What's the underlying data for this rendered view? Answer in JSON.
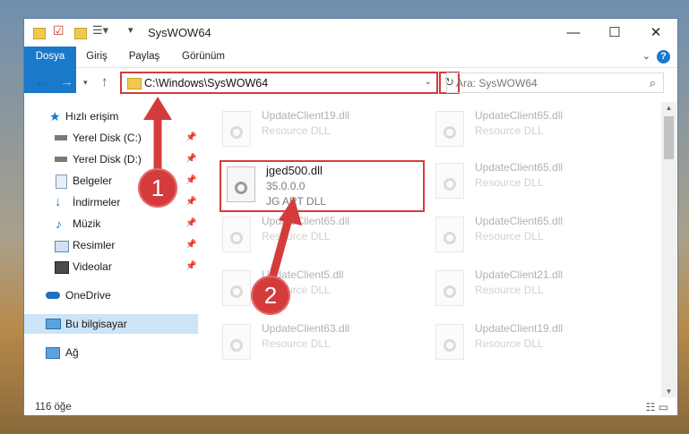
{
  "window": {
    "title": "SysWOW64",
    "controls": {
      "minimize": "—",
      "maximize": "☐",
      "close": "✕"
    }
  },
  "ribbon": {
    "tabs": [
      "Dosya",
      "Giriş",
      "Paylaş",
      "Görünüm"
    ],
    "help": "?"
  },
  "address": {
    "path": "C:\\Windows\\SysWOW64",
    "search_placeholder": "Ara: SysWOW64"
  },
  "sidebar": {
    "items": [
      {
        "label": "Hızlı erişim",
        "icon": "star-icon",
        "pinned": false
      },
      {
        "label": "Yerel Disk (C:)",
        "icon": "drive-icon",
        "pinned": true
      },
      {
        "label": "Yerel Disk (D:)",
        "icon": "drive-icon",
        "pinned": true
      },
      {
        "label": "Belgeler",
        "icon": "documents-icon",
        "pinned": true
      },
      {
        "label": "İndirmeler",
        "icon": "download-icon",
        "pinned": true
      },
      {
        "label": "Müzik",
        "icon": "music-icon",
        "pinned": true
      },
      {
        "label": "Resimler",
        "icon": "pictures-icon",
        "pinned": true
      },
      {
        "label": "Videolar",
        "icon": "video-icon",
        "pinned": true
      },
      {
        "label": "OneDrive",
        "icon": "cloud-icon",
        "pinned": false
      },
      {
        "label": "Bu bilgisayar",
        "icon": "computer-icon",
        "pinned": false,
        "selected": true
      },
      {
        "label": "Ağ",
        "icon": "network-icon",
        "pinned": false
      }
    ]
  },
  "files": {
    "highlighted": {
      "name": "jged500.dll",
      "version": "35.0.0.0",
      "description": "JG ART DLL"
    },
    "left_column": [
      {
        "name": "UpdateClient19.dll",
        "description": "Resource DLL"
      },
      {
        "name": "UpdateClient65.dll",
        "description": "Resource DLL"
      },
      {
        "name": "UpdateClient5.dll",
        "description": "Resource DLL"
      },
      {
        "name": "UpdateClient63.dll",
        "description": "Resource DLL"
      }
    ],
    "right_column": [
      {
        "name": "UpdateClient65.dll",
        "description": "Resource DLL"
      },
      {
        "name": "UpdateClient65.dll",
        "description": "Resource DLL"
      },
      {
        "name": "UpdateClient65.dll",
        "description": "Resource DLL"
      },
      {
        "name": "UpdateClient21.dll",
        "description": "Resource DLL"
      },
      {
        "name": "UpdateClient19.dll",
        "description": "Resource DLL"
      }
    ]
  },
  "status": {
    "item_count": "116 öğe"
  },
  "annotations": {
    "step1": "1",
    "step2": "2"
  },
  "colors": {
    "accent": "#1979ca",
    "annotation": "#d63a3a",
    "selected": "#cce4f7"
  }
}
